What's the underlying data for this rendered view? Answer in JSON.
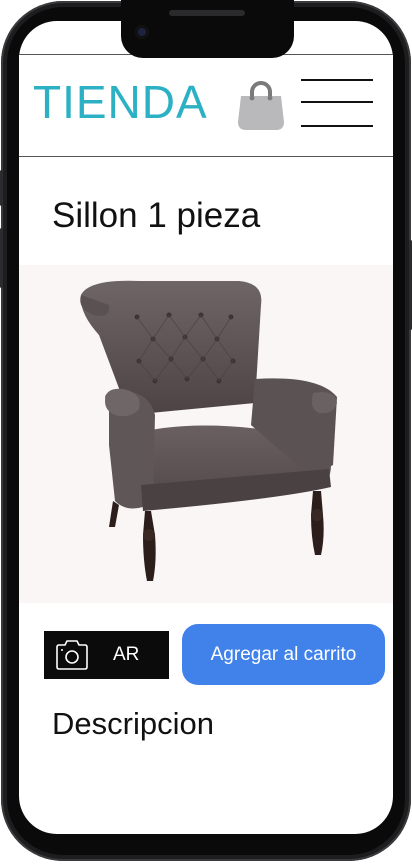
{
  "header": {
    "logo": "TIENDA",
    "bag_icon": "shopping-bag-icon",
    "menu_icon": "hamburger-menu-icon"
  },
  "product": {
    "title": "Sillon 1 pieza",
    "image": "armchair-image"
  },
  "actions": {
    "ar_label": "AR",
    "ar_icon": "camera-icon",
    "cart_label": "Agregar al carrito"
  },
  "description": {
    "title": "Descripcion"
  },
  "colors": {
    "brand": "#2bb1c3",
    "cart_button": "#4181ea",
    "ar_button": "#0b0b0b"
  }
}
